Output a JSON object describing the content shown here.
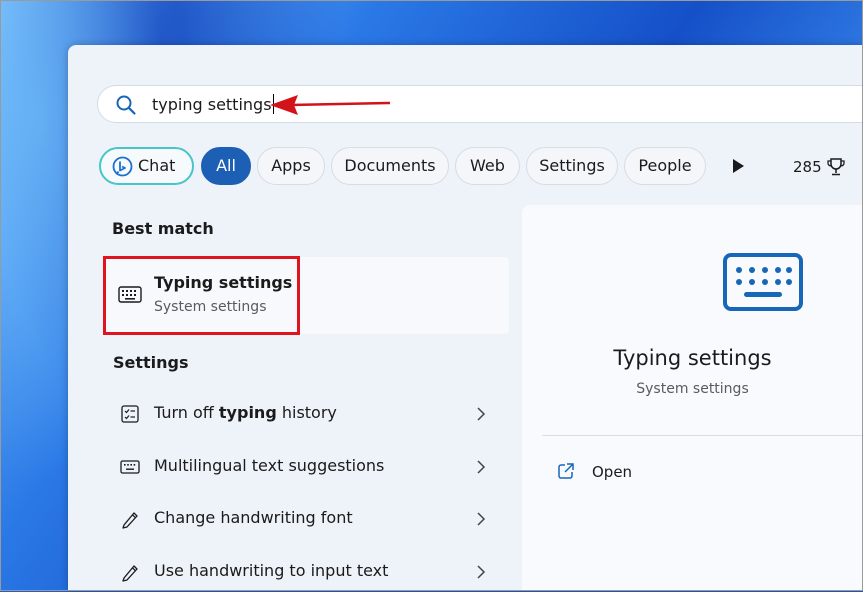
{
  "search": {
    "query": "typing settings"
  },
  "filters": {
    "chat": "Chat",
    "all": "All",
    "apps": "Apps",
    "documents": "Documents",
    "web": "Web",
    "settings": "Settings",
    "people": "People",
    "points": "285"
  },
  "best_match": {
    "heading": "Best match",
    "title": "Typing settings",
    "subtitle": "System settings"
  },
  "settings": {
    "heading": "Settings",
    "items": [
      {
        "prefix": "Turn off ",
        "bold": "typing",
        "suffix": " history",
        "icon": "history-list-icon"
      },
      {
        "label": "Multilingual text suggestions",
        "icon": "keyboard-icon"
      },
      {
        "label": "Change handwriting font",
        "icon": "pen-icon"
      },
      {
        "label": "Use handwriting to input text",
        "icon": "pen-icon"
      }
    ]
  },
  "preview": {
    "title": "Typing settings",
    "subtitle": "System settings",
    "open_label": "Open"
  },
  "colors": {
    "accent": "#1d5fb5",
    "highlight_box": "#e0141e",
    "chat_ring": "#47c5c8",
    "icon_blue": "#1766b8"
  }
}
